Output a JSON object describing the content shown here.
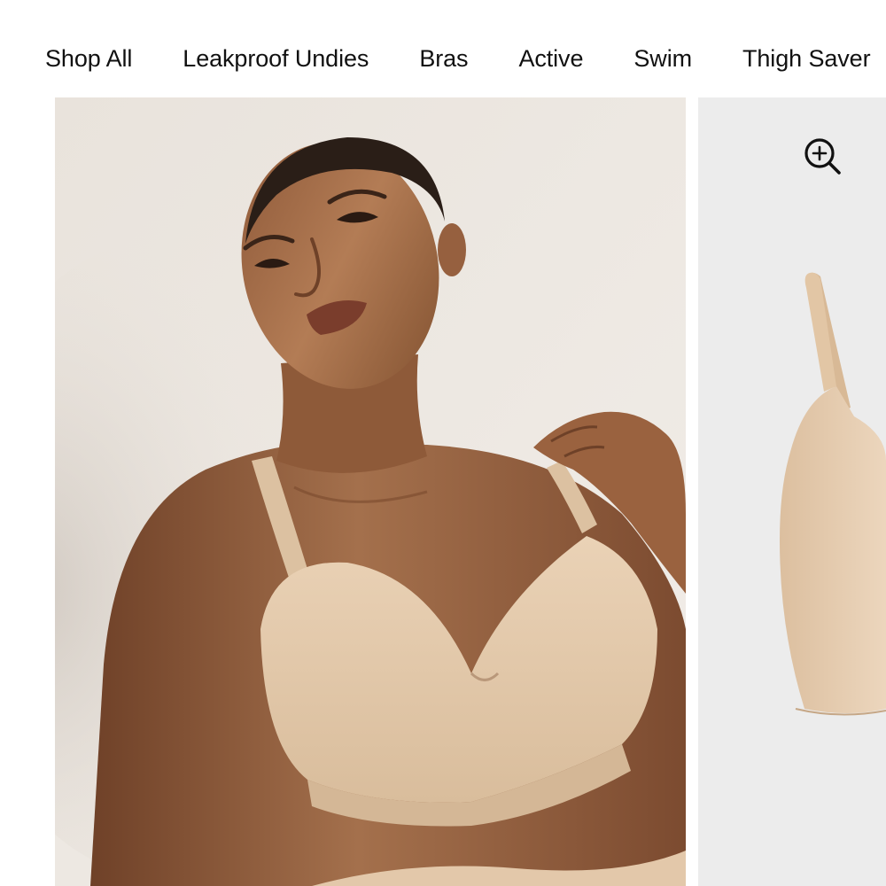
{
  "nav": {
    "items": [
      {
        "label": "Shop All"
      },
      {
        "label": "Leakproof Undies"
      },
      {
        "label": "Bras"
      },
      {
        "label": "Active"
      },
      {
        "label": "Swim"
      },
      {
        "label": "Thigh Saver"
      }
    ]
  },
  "gallery": {
    "slides": [
      {
        "kind": "model-photo",
        "bra_color": "#e3c8aa",
        "backdrop_color": "#ebe6e0"
      },
      {
        "kind": "product-flat-lay",
        "bra_color": "#e3c8aa",
        "backdrop_color": "#ececec",
        "zoom_icon": "zoom-in-icon"
      }
    ]
  },
  "colors": {
    "text": "#111111",
    "skin_tone": "#9a623f",
    "hair": "#2a1e17"
  }
}
